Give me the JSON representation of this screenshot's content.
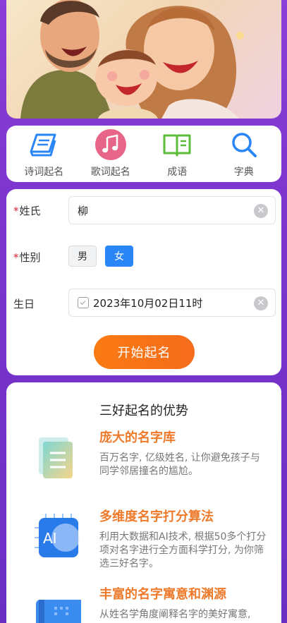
{
  "nav": {
    "items": [
      {
        "label": "诗词起名",
        "icon": "poetry-book-icon"
      },
      {
        "label": "歌词起名",
        "icon": "music-note-icon"
      },
      {
        "label": "成语",
        "icon": "open-book-icon"
      },
      {
        "label": "字典",
        "icon": "search-icon"
      }
    ]
  },
  "form": {
    "surname": {
      "required_mark": "*",
      "label": "姓氏",
      "value": "柳"
    },
    "gender": {
      "required_mark": "*",
      "label": "性别",
      "options": [
        "男",
        "女"
      ],
      "selected": "女"
    },
    "birthday": {
      "label": "生日",
      "value": "2023年10月02日11时"
    },
    "submit_label": "开始起名"
  },
  "advantages": {
    "title": "三好起名的优势",
    "features": [
      {
        "title": "庞大的名字库",
        "desc": "百万名字, 亿级姓名, 让你避免孩子与同学邻居撞名的尴尬。",
        "icon": "name-library-icon"
      },
      {
        "title": "多维度名字打分算法",
        "desc": "利用大数据和AI技术, 根据50多个打分项对名字进行全方面科学打分, 为你筛选三好名字。",
        "icon": "ai-chip-icon"
      },
      {
        "title": "丰富的名字寓意和渊源",
        "desc": "从姓名学角度阐释名字的美好寓意,",
        "icon": "book-icon"
      }
    ]
  },
  "colors": {
    "accent": "#2a85f7",
    "orange": "#f56c1b",
    "feature_title": "#ee7a2c",
    "background": "#7a34cc"
  }
}
